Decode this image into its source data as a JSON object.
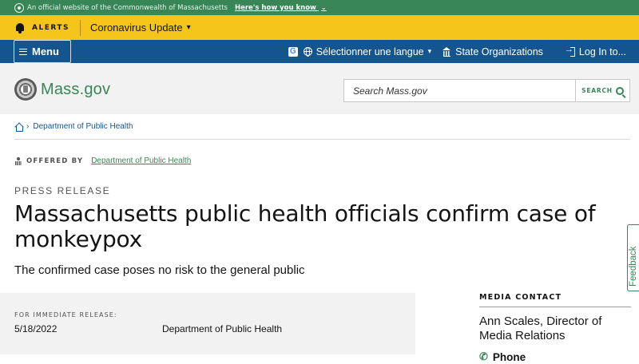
{
  "official_bar": {
    "text": "An official website of the Commonwealth of Massachusetts",
    "link": "Here's how you know",
    "chevron": "⌄"
  },
  "alerts": {
    "label": "ALERTS",
    "item": "Coronavirus Update",
    "item_chevron": "▾"
  },
  "nav": {
    "menu_label": "Menu",
    "google_badge": "G",
    "language_label": "Sélectionner une langue",
    "language_chevron": "▾",
    "state_orgs_label": "State Organizations",
    "login_label": "Log In to..."
  },
  "header": {
    "logo_text": "Mass.gov",
    "search_placeholder": "Search Mass.gov",
    "search_button": "SEARCH"
  },
  "breadcrumb": {
    "separator": "›",
    "items": [
      {
        "label": "Department of Public Health"
      }
    ]
  },
  "offered_by": {
    "label": "OFFERED BY",
    "org": "Department of Public Health"
  },
  "press_release": {
    "kicker": "PRESS RELEASE",
    "title": "Massachusetts public health officials confirm case of monkeypox",
    "subtitle": "The confirmed case poses no risk to the general public"
  },
  "release_info": {
    "label": "FOR IMMEDIATE RELEASE:",
    "date": "5/18/2022",
    "org": "Department of Public Health"
  },
  "media_contact": {
    "heading": "MEDIA CONTACT",
    "name": "Ann Scales, Director of Media Relations",
    "phone_label": "Phone",
    "phone_icon": "✆"
  },
  "feedback": {
    "label": "Feedback"
  },
  "colors": {
    "official_green": "#388557",
    "alert_yellow": "#f6c51b",
    "nav_blue": "#14558f",
    "header_gray": "#f2f2f2",
    "text_dark": "#141414",
    "link_blue": "#14558f"
  }
}
